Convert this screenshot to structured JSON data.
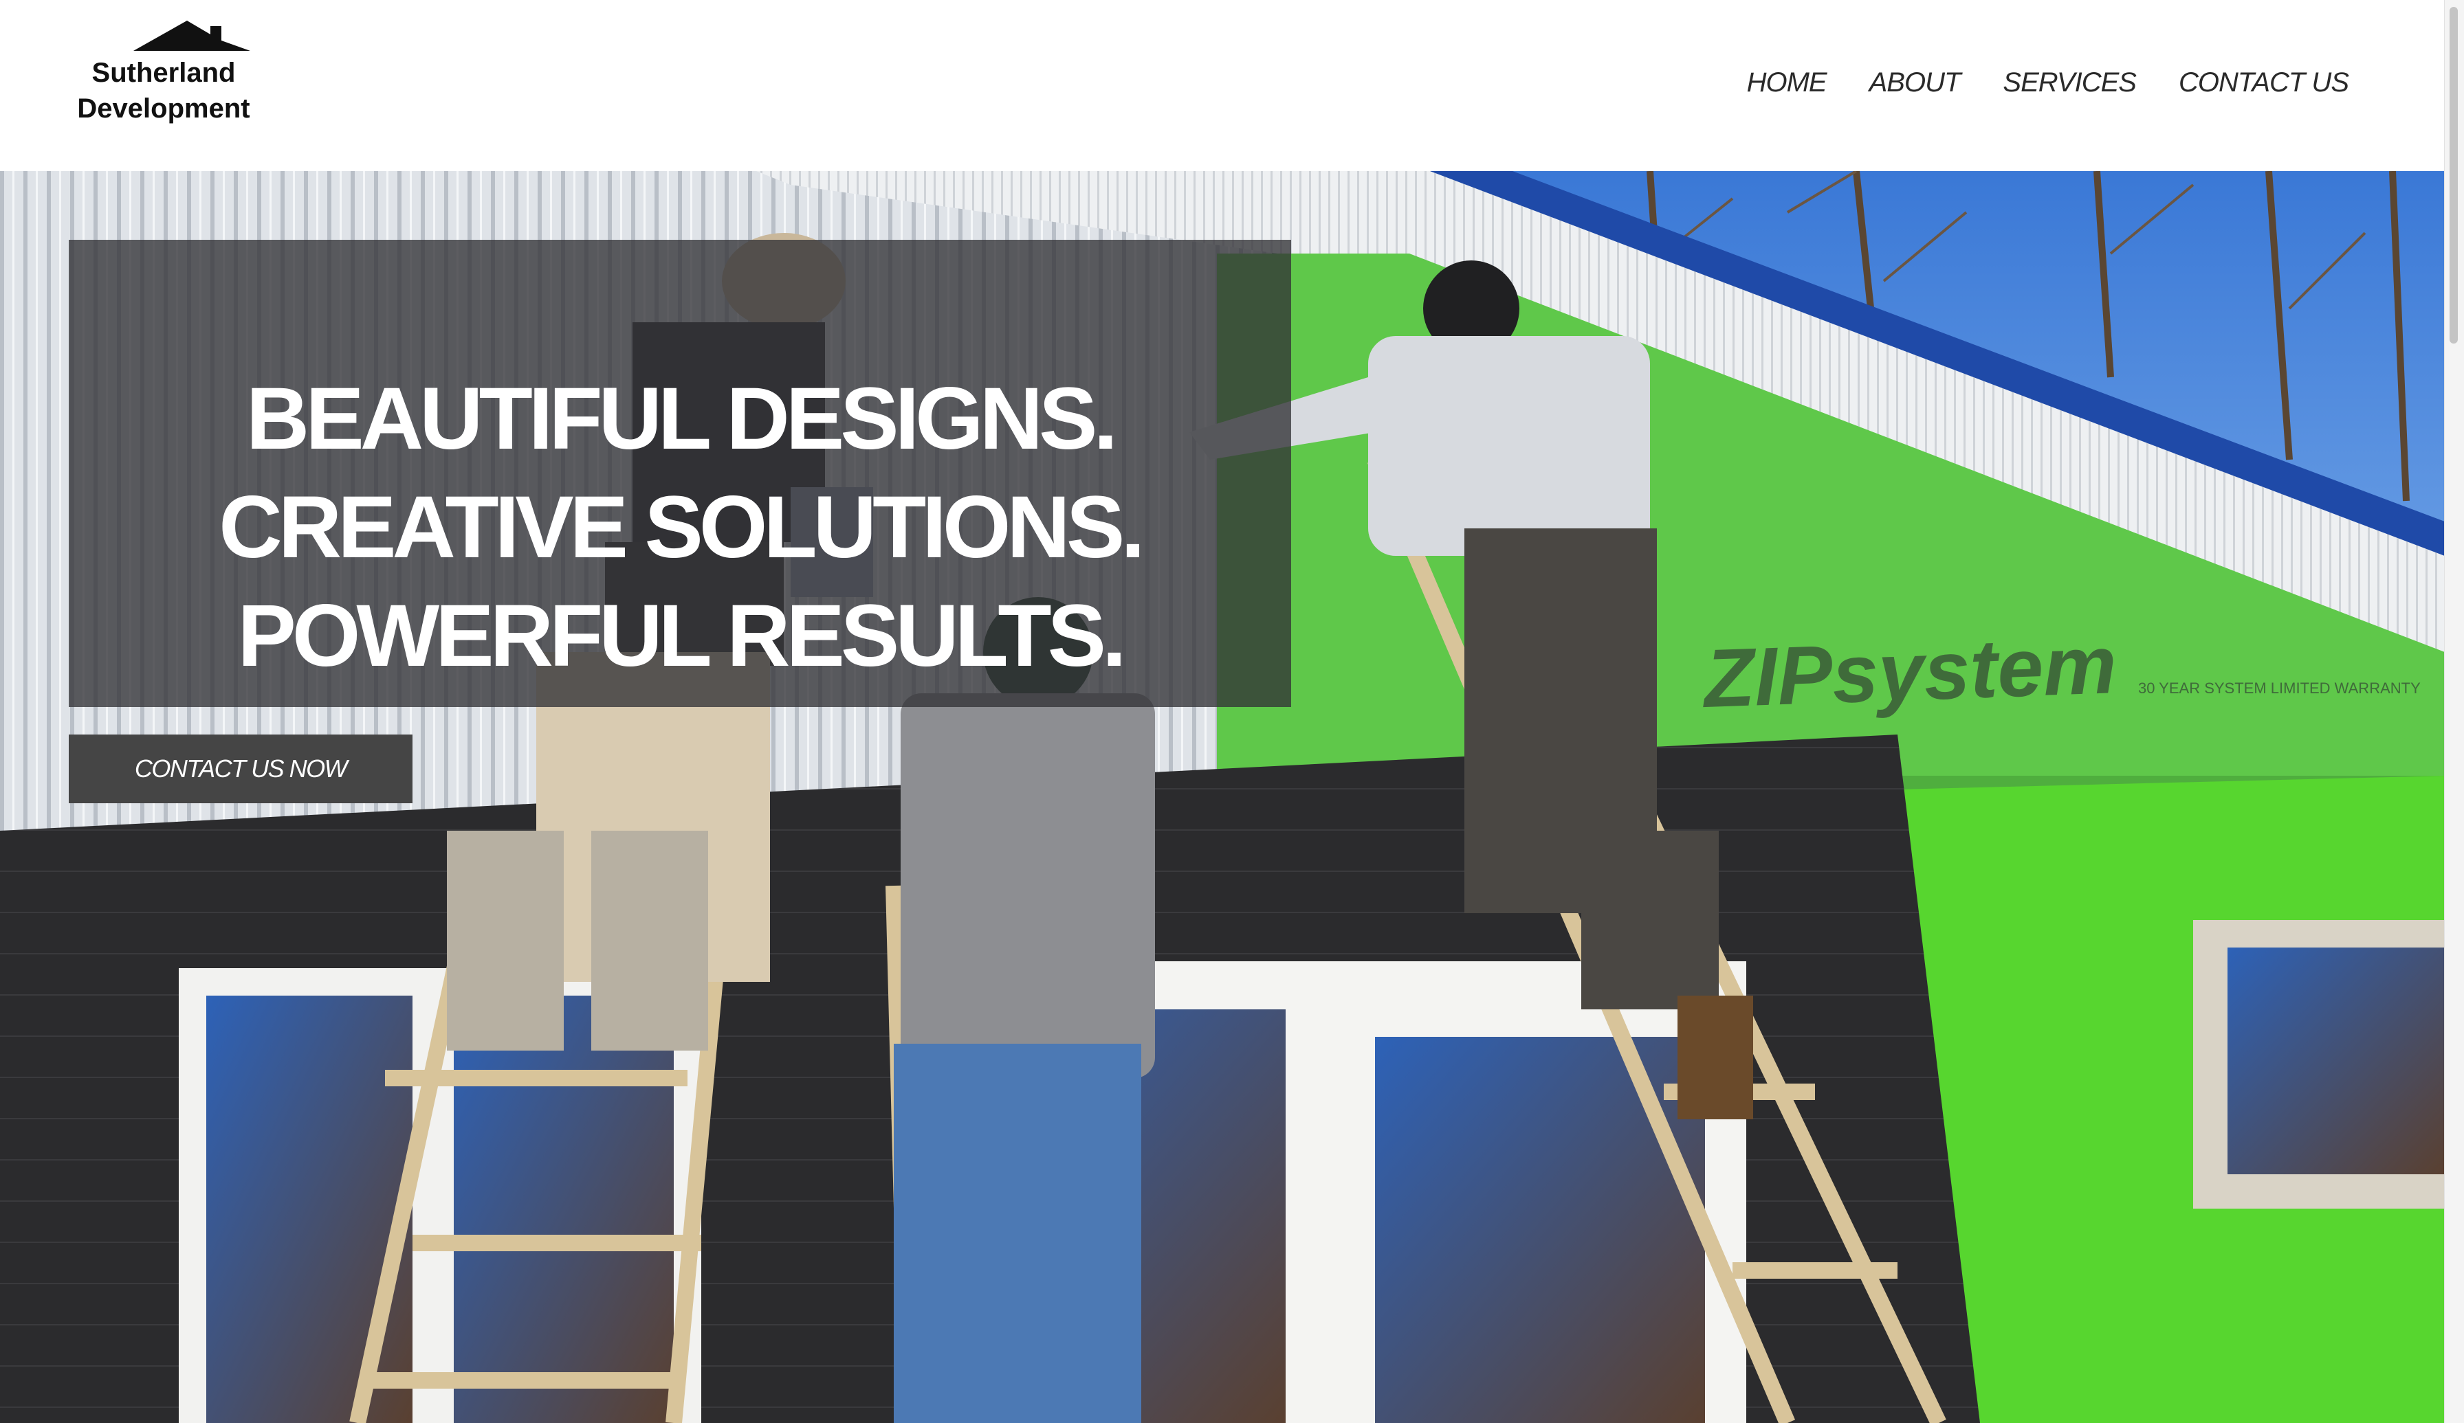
{
  "header": {
    "logo": {
      "line1": "Sutherland",
      "line2": "Development"
    },
    "nav": [
      {
        "label": "HOME"
      },
      {
        "label": "ABOUT"
      },
      {
        "label": "SERVICES"
      },
      {
        "label": "CONTACT US"
      }
    ]
  },
  "hero": {
    "headline": [
      "BEAUTIFUL DESIGNS.",
      "CREATIVE SOLUTIONS.",
      "POWERFUL RESULTS."
    ],
    "cta_label": "CONTACT US NOW",
    "photo_alt": "Builders on ladders installing siding and ZIP System sheathing on a house",
    "sheathing_brand": "ZIPsystem",
    "sheathing_warranty": "30 YEAR SYSTEM LIMITED WARRANTY"
  },
  "colors": {
    "header_bg": "#ffffff",
    "overlay_box": "#323236",
    "cta_bg": "#454545",
    "sheathing_green": "#5fc84a",
    "sky_blue": "#3f7fd8"
  }
}
